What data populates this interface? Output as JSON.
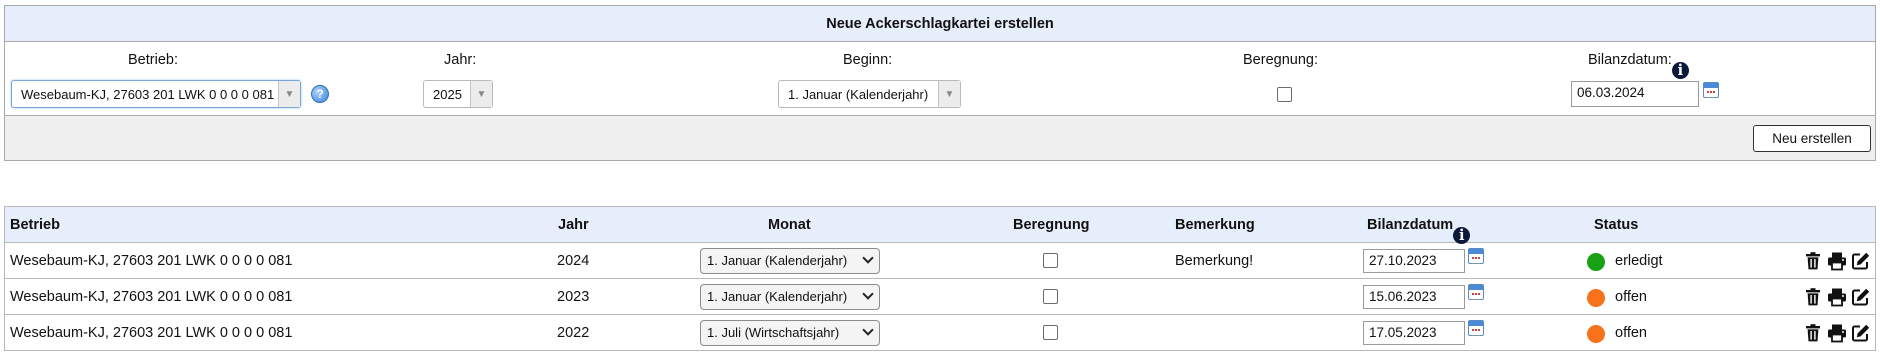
{
  "form": {
    "title": "Neue Ackerschlagkartei erstellen",
    "labels": {
      "betrieb": "Betrieb:",
      "jahr": "Jahr:",
      "beginn": "Beginn:",
      "beregnung": "Beregnung:",
      "bilanzdatum": "Bilanzdatum:"
    },
    "betrieb_value": "Wesebaum-KJ, 27603 201 LWK 0 0 0 0 081",
    "jahr_value": "2025",
    "beginn_value": "1. Januar (Kalenderjahr)",
    "beregnung_checked": false,
    "bilanzdatum_value": "06.03.2024",
    "help_icon": "?",
    "info_icon": "i",
    "submit_label": "Neu erstellen"
  },
  "table": {
    "headers": {
      "betrieb": "Betrieb",
      "jahr": "Jahr",
      "monat": "Monat",
      "beregnung": "Beregnung",
      "bemerkung": "Bemerkung",
      "bilanzdatum": "Bilanzdatum",
      "status": "Status"
    },
    "info_icon": "i",
    "rows": [
      {
        "betrieb": "Wesebaum-KJ, 27603 201 LWK 0 0 0 0 081",
        "jahr": "2024",
        "monat": "1. Januar (Kalenderjahr)",
        "beregnung": false,
        "bemerkung": "Bemerkung!",
        "bilanzdatum": "27.10.2023",
        "status": "erledigt",
        "status_color": "#18a114"
      },
      {
        "betrieb": "Wesebaum-KJ, 27603 201 LWK 0 0 0 0 081",
        "jahr": "2023",
        "monat": "1. Januar (Kalenderjahr)",
        "beregnung": false,
        "bemerkung": "",
        "bilanzdatum": "15.06.2023",
        "status": "offen",
        "status_color": "#f7731b"
      },
      {
        "betrieb": "Wesebaum-KJ, 27603 201 LWK 0 0 0 0 081",
        "jahr": "2022",
        "monat": "1. Juli (Wirtschaftsjahr)",
        "beregnung": false,
        "bemerkung": "",
        "bilanzdatum": "17.05.2023",
        "status": "offen",
        "status_color": "#f7731b"
      }
    ],
    "actions": [
      "trash-icon",
      "print-icon",
      "edit-icon"
    ]
  }
}
